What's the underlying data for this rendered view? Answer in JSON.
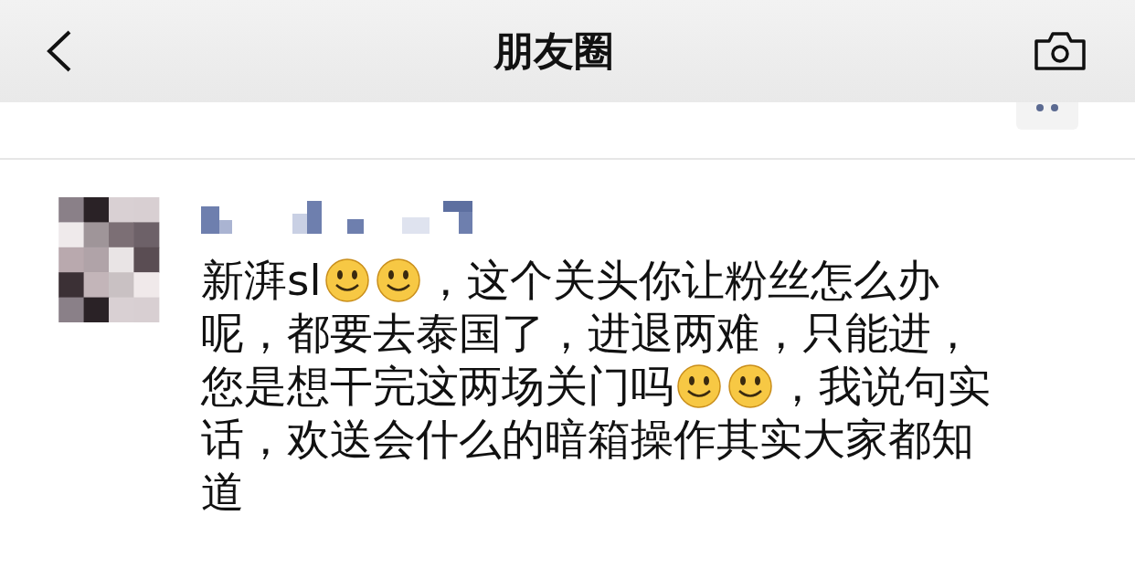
{
  "header": {
    "title": "朋友圈"
  },
  "post": {
    "lines": [
      [
        {
          "kind": "text",
          "text": "新湃sl"
        },
        {
          "kind": "emoji"
        },
        {
          "kind": "emoji"
        },
        {
          "kind": "text",
          "text": "，这个关头你让粉丝怎么办"
        }
      ],
      [
        {
          "kind": "text",
          "text": "呢，都要去泰国了，进退两难，只能进，"
        }
      ],
      [
        {
          "kind": "text",
          "text": "您是想干完这两场关门吗"
        },
        {
          "kind": "emoji"
        },
        {
          "kind": "emoji"
        },
        {
          "kind": "text",
          "text": "，我说句实"
        }
      ],
      [
        {
          "kind": "text",
          "text": "话，欢送会什么的暗箱操作其实大家都知"
        }
      ],
      [
        {
          "kind": "text",
          "text": "道"
        }
      ]
    ]
  }
}
